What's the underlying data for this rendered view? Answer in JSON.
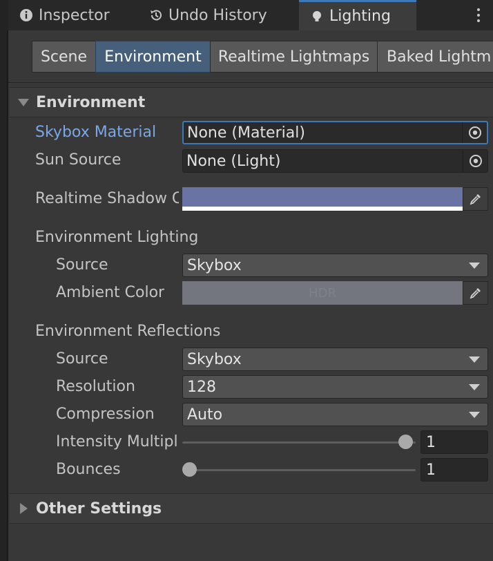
{
  "tabs": [
    {
      "label": "Inspector",
      "icon": "info-icon"
    },
    {
      "label": "Undo History",
      "icon": "history-icon"
    },
    {
      "label": "Lighting",
      "icon": "lightbulb-icon",
      "active": true
    }
  ],
  "toolbar": {
    "buttons": [
      "Scene",
      "Environment",
      "Realtime Lightmaps",
      "Baked Lightm"
    ],
    "active": "Environment"
  },
  "environment": {
    "header": "Environment",
    "skybox_label": "Skybox Material",
    "skybox_value": "None (Material)",
    "sun_label": "Sun Source",
    "sun_value": "None (Light)",
    "shadow_label": "Realtime Shadow C",
    "shadow_color": "#6a74a4",
    "lighting_header": "Environment Lighting",
    "lighting_source_label": "Source",
    "lighting_source_value": "Skybox",
    "ambient_label": "Ambient Color",
    "ambient_color": "#73767f",
    "ambient_overlay": "HDR",
    "reflections_header": "Environment Reflections",
    "refl_source_label": "Source",
    "refl_source_value": "Skybox",
    "resolution_label": "Resolution",
    "resolution_value": "128",
    "compression_label": "Compression",
    "compression_value": "Auto",
    "intensity_label": "Intensity Multipl",
    "intensity_value": "1",
    "intensity_fraction": 1.0,
    "bounces_label": "Bounces",
    "bounces_value": "1",
    "bounces_fraction": 0.0
  },
  "other": {
    "header": "Other Settings"
  },
  "colors": {
    "accent": "#3d79b9",
    "focused_label": "#7aa7e6",
    "active_segment": "#46607c"
  }
}
